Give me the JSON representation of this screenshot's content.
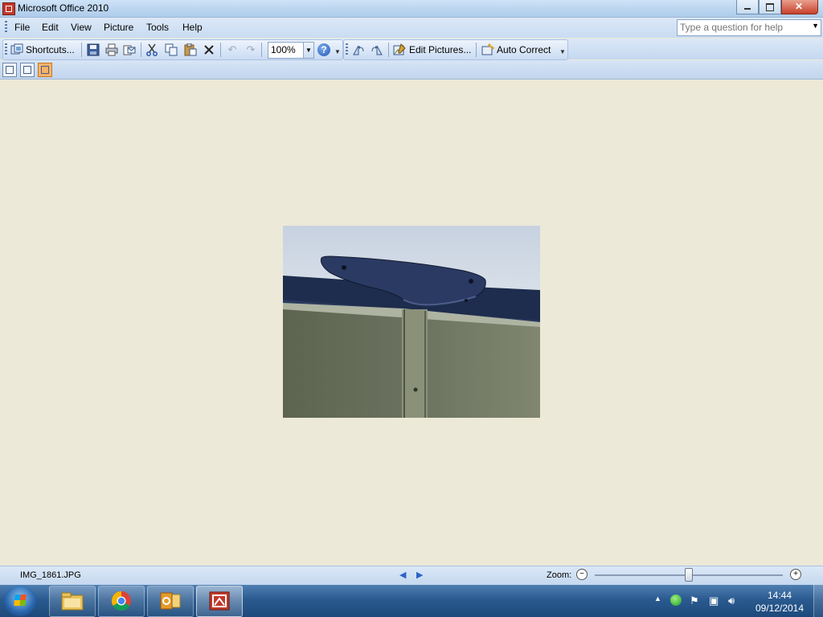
{
  "window": {
    "title": "Microsoft Office 2010"
  },
  "menu": {
    "items": [
      {
        "label": "File"
      },
      {
        "label": "Edit"
      },
      {
        "label": "View"
      },
      {
        "label": "Picture"
      },
      {
        "label": "Tools"
      },
      {
        "label": "Help"
      }
    ],
    "help_placeholder": "Type a question for help"
  },
  "toolbar": {
    "shortcuts_label": "Shortcuts...",
    "zoom_value": "100%",
    "edit_pictures_label": "Edit Pictures...",
    "auto_correct_label": "Auto Correct",
    "icons": [
      "save-icon",
      "print-icon",
      "email-icon",
      "cut-icon",
      "copy-icon",
      "paste-icon",
      "delete-icon",
      "undo-icon",
      "redo-icon",
      "help-icon",
      "rotate-left-icon",
      "rotate-right-icon"
    ]
  },
  "viewbar": {
    "active_view": "single-picture-view"
  },
  "status": {
    "filename": "IMG_1861.JPG",
    "zoom_label": "Zoom:",
    "zoom_slider_value": 0.5
  },
  "taskbar": {
    "apps": [
      "windows-explorer-icon",
      "chrome-icon",
      "outlook-icon",
      "picture-manager-icon"
    ],
    "time": "14:44",
    "date": "09/12/2014"
  },
  "colors": {
    "title_bar": "#c3dbf3",
    "content_bg": "#ece9d8",
    "taskbar": "#2a5a8f",
    "close_button": "#c8412a"
  }
}
